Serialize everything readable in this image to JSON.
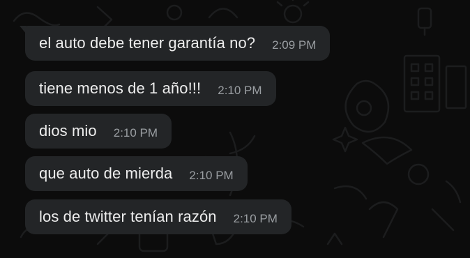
{
  "conversation": {
    "messages": [
      {
        "text": "el auto debe tener garantía no?",
        "time": "2:09 PM"
      },
      {
        "text": "tiene menos de 1 año!!!",
        "time": "2:10 PM"
      },
      {
        "text": "dios mio",
        "time": "2:10 PM"
      },
      {
        "text": "que auto de mierda",
        "time": "2:10 PM"
      },
      {
        "text": "los de twitter tenían razón",
        "time": "2:10 PM"
      }
    ]
  },
  "colors": {
    "background": "#0c0c0c",
    "bubble": "#232527",
    "text": "#ededed",
    "timestamp": "#9a9ea2"
  }
}
